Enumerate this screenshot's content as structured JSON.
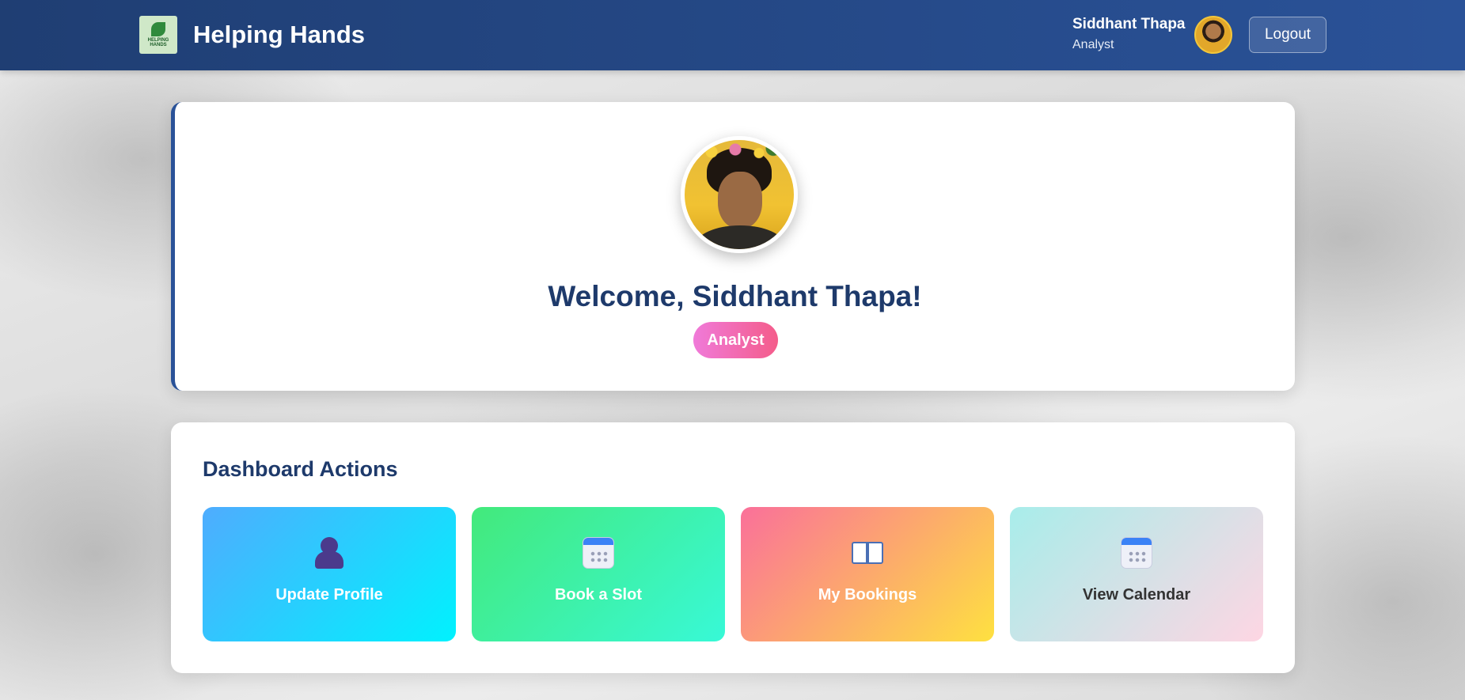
{
  "header": {
    "brand": "Helping Hands",
    "logo_text": "HELPING HANDS",
    "user_name": "Siddhant Thapa",
    "user_role": "Analyst",
    "logout_label": "Logout"
  },
  "welcome": {
    "title": "Welcome, Siddhant Thapa!",
    "role_badge": "Analyst"
  },
  "actions": {
    "title": "Dashboard Actions",
    "items": [
      {
        "label": "Update Profile",
        "icon": "person-icon"
      },
      {
        "label": "Book a Slot",
        "icon": "calendar-icon"
      },
      {
        "label": "My Bookings",
        "icon": "book-icon"
      },
      {
        "label": "View Calendar",
        "icon": "calendar-icon"
      }
    ]
  },
  "colors": {
    "header_start": "#1f3e73",
    "header_end": "#2a5298",
    "title": "#1e3a6b",
    "badge_start": "#f07ad9",
    "badge_end": "#f45c8a"
  }
}
